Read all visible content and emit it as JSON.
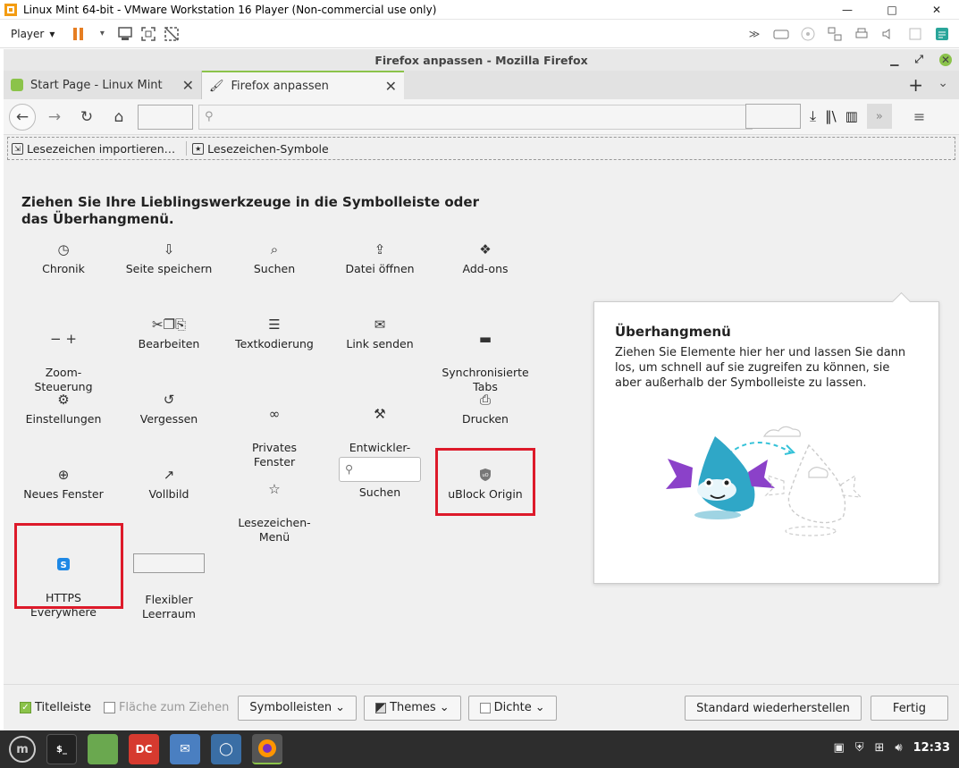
{
  "vm": {
    "title": "Linux Mint 64-bit - VMware Workstation 16 Player (Non-commercial use only)",
    "player_label": "Player",
    "min_icon": "—",
    "max_icon": "□",
    "close_icon": "✕"
  },
  "firefox": {
    "window_title": "Firefox anpassen - Mozilla Firefox",
    "tabs": [
      {
        "label": "Start Page - Linux Mint",
        "active": false
      },
      {
        "label": "Firefox anpassen",
        "active": true
      }
    ],
    "bookmarks": [
      {
        "label": "Lesezeichen importieren…"
      },
      {
        "label": "Lesezeichen-Symbole"
      }
    ]
  },
  "customize": {
    "heading": "Ziehen Sie Ihre Lieblingswerkzeuge in die Symbolleiste oder das Überhangmenü.",
    "items": [
      {
        "label": "Chronik",
        "icon": "◷"
      },
      {
        "label": "Seite speichern",
        "icon": "⇩"
      },
      {
        "label": "Suchen",
        "icon": "⌕"
      },
      {
        "label": "Datei öffnen",
        "icon": "⇪"
      },
      {
        "label": "Add-ons",
        "icon": "❖"
      },
      {
        "label": "Zoom-\nSteuerung",
        "icon": "− +"
      },
      {
        "label": "Bearbeiten",
        "icon": "✂❐⎘"
      },
      {
        "label": "Textkodierung",
        "icon": "☰"
      },
      {
        "label": "Link senden",
        "icon": "✉"
      },
      {
        "label": "Synchronisierte\nTabs",
        "icon": "▬"
      },
      {
        "label": "Einstellungen",
        "icon": "⚙"
      },
      {
        "label": "Vergessen",
        "icon": "↺"
      },
      {
        "label": "Privates\nFenster",
        "icon": "∞"
      },
      {
        "label": "Entwickler-\nWerkzeuge",
        "icon": "⚒"
      },
      {
        "label": "Drucken",
        "icon": "⎙"
      },
      {
        "label": "Neues Fenster",
        "icon": "⊕"
      },
      {
        "label": "Vollbild",
        "icon": "↗"
      },
      {
        "label": "Lesezeichen-\nMenü",
        "icon": "☆"
      },
      {
        "label": "Suchen",
        "icon": "search-box"
      },
      {
        "label": "uBlock Origin",
        "icon": "◆"
      },
      {
        "label": "HTTPS\nEverywhere",
        "icon": "S"
      },
      {
        "label": "Flexibler\nLeerraum",
        "icon": "flex-box"
      }
    ]
  },
  "overflow": {
    "title": "Überhangmenü",
    "description": "Ziehen Sie Elemente hier her und lassen Sie dann los, um schnell auf sie zugreifen zu können, sie aber außerhalb der Symbolleiste zu lassen."
  },
  "bottom": {
    "titlebar_label": "Titelleiste",
    "dragspace_label": "Fläche zum Ziehen",
    "toolbars_label": "Symbolleisten",
    "themes_label": "Themes",
    "density_label": "Dichte",
    "restore_label": "Standard wiederherstellen",
    "done_label": "Fertig"
  },
  "taskbar": {
    "clock": "12:33"
  },
  "colors": {
    "accent": "#8bc34a",
    "highlight": "#dd1a2a"
  }
}
